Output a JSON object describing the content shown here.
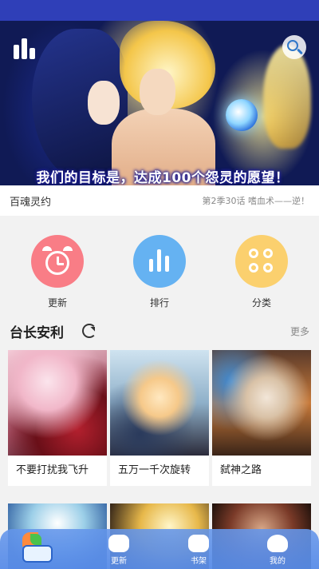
{
  "banner": {
    "caption": "我们的目标是，达成100个怨灵的愿望！"
  },
  "featured": {
    "title": "百魂灵约",
    "episode": "第2季30话 嗜血术——逆！"
  },
  "menu": {
    "items": [
      {
        "label": "更新",
        "color": "#f97d86",
        "icon": "alarm-clock-icon"
      },
      {
        "label": "排行",
        "color": "#65b2f2",
        "icon": "bar-chart-icon"
      },
      {
        "label": "分类",
        "color": "#fbd06e",
        "icon": "grid-icon"
      }
    ]
  },
  "section": {
    "title": "台长安利",
    "more": "更多"
  },
  "cards": [
    {
      "title": "不要打扰我飞升"
    },
    {
      "title": "五万一千次旋转"
    },
    {
      "title": "弑神之路"
    }
  ],
  "tabbar": {
    "items": [
      {
        "label": "更新"
      },
      {
        "label": "书架"
      },
      {
        "label": "我的"
      }
    ]
  },
  "colors": {
    "status_bar": "#2f3fb8",
    "tabbar": "#6496eb"
  }
}
